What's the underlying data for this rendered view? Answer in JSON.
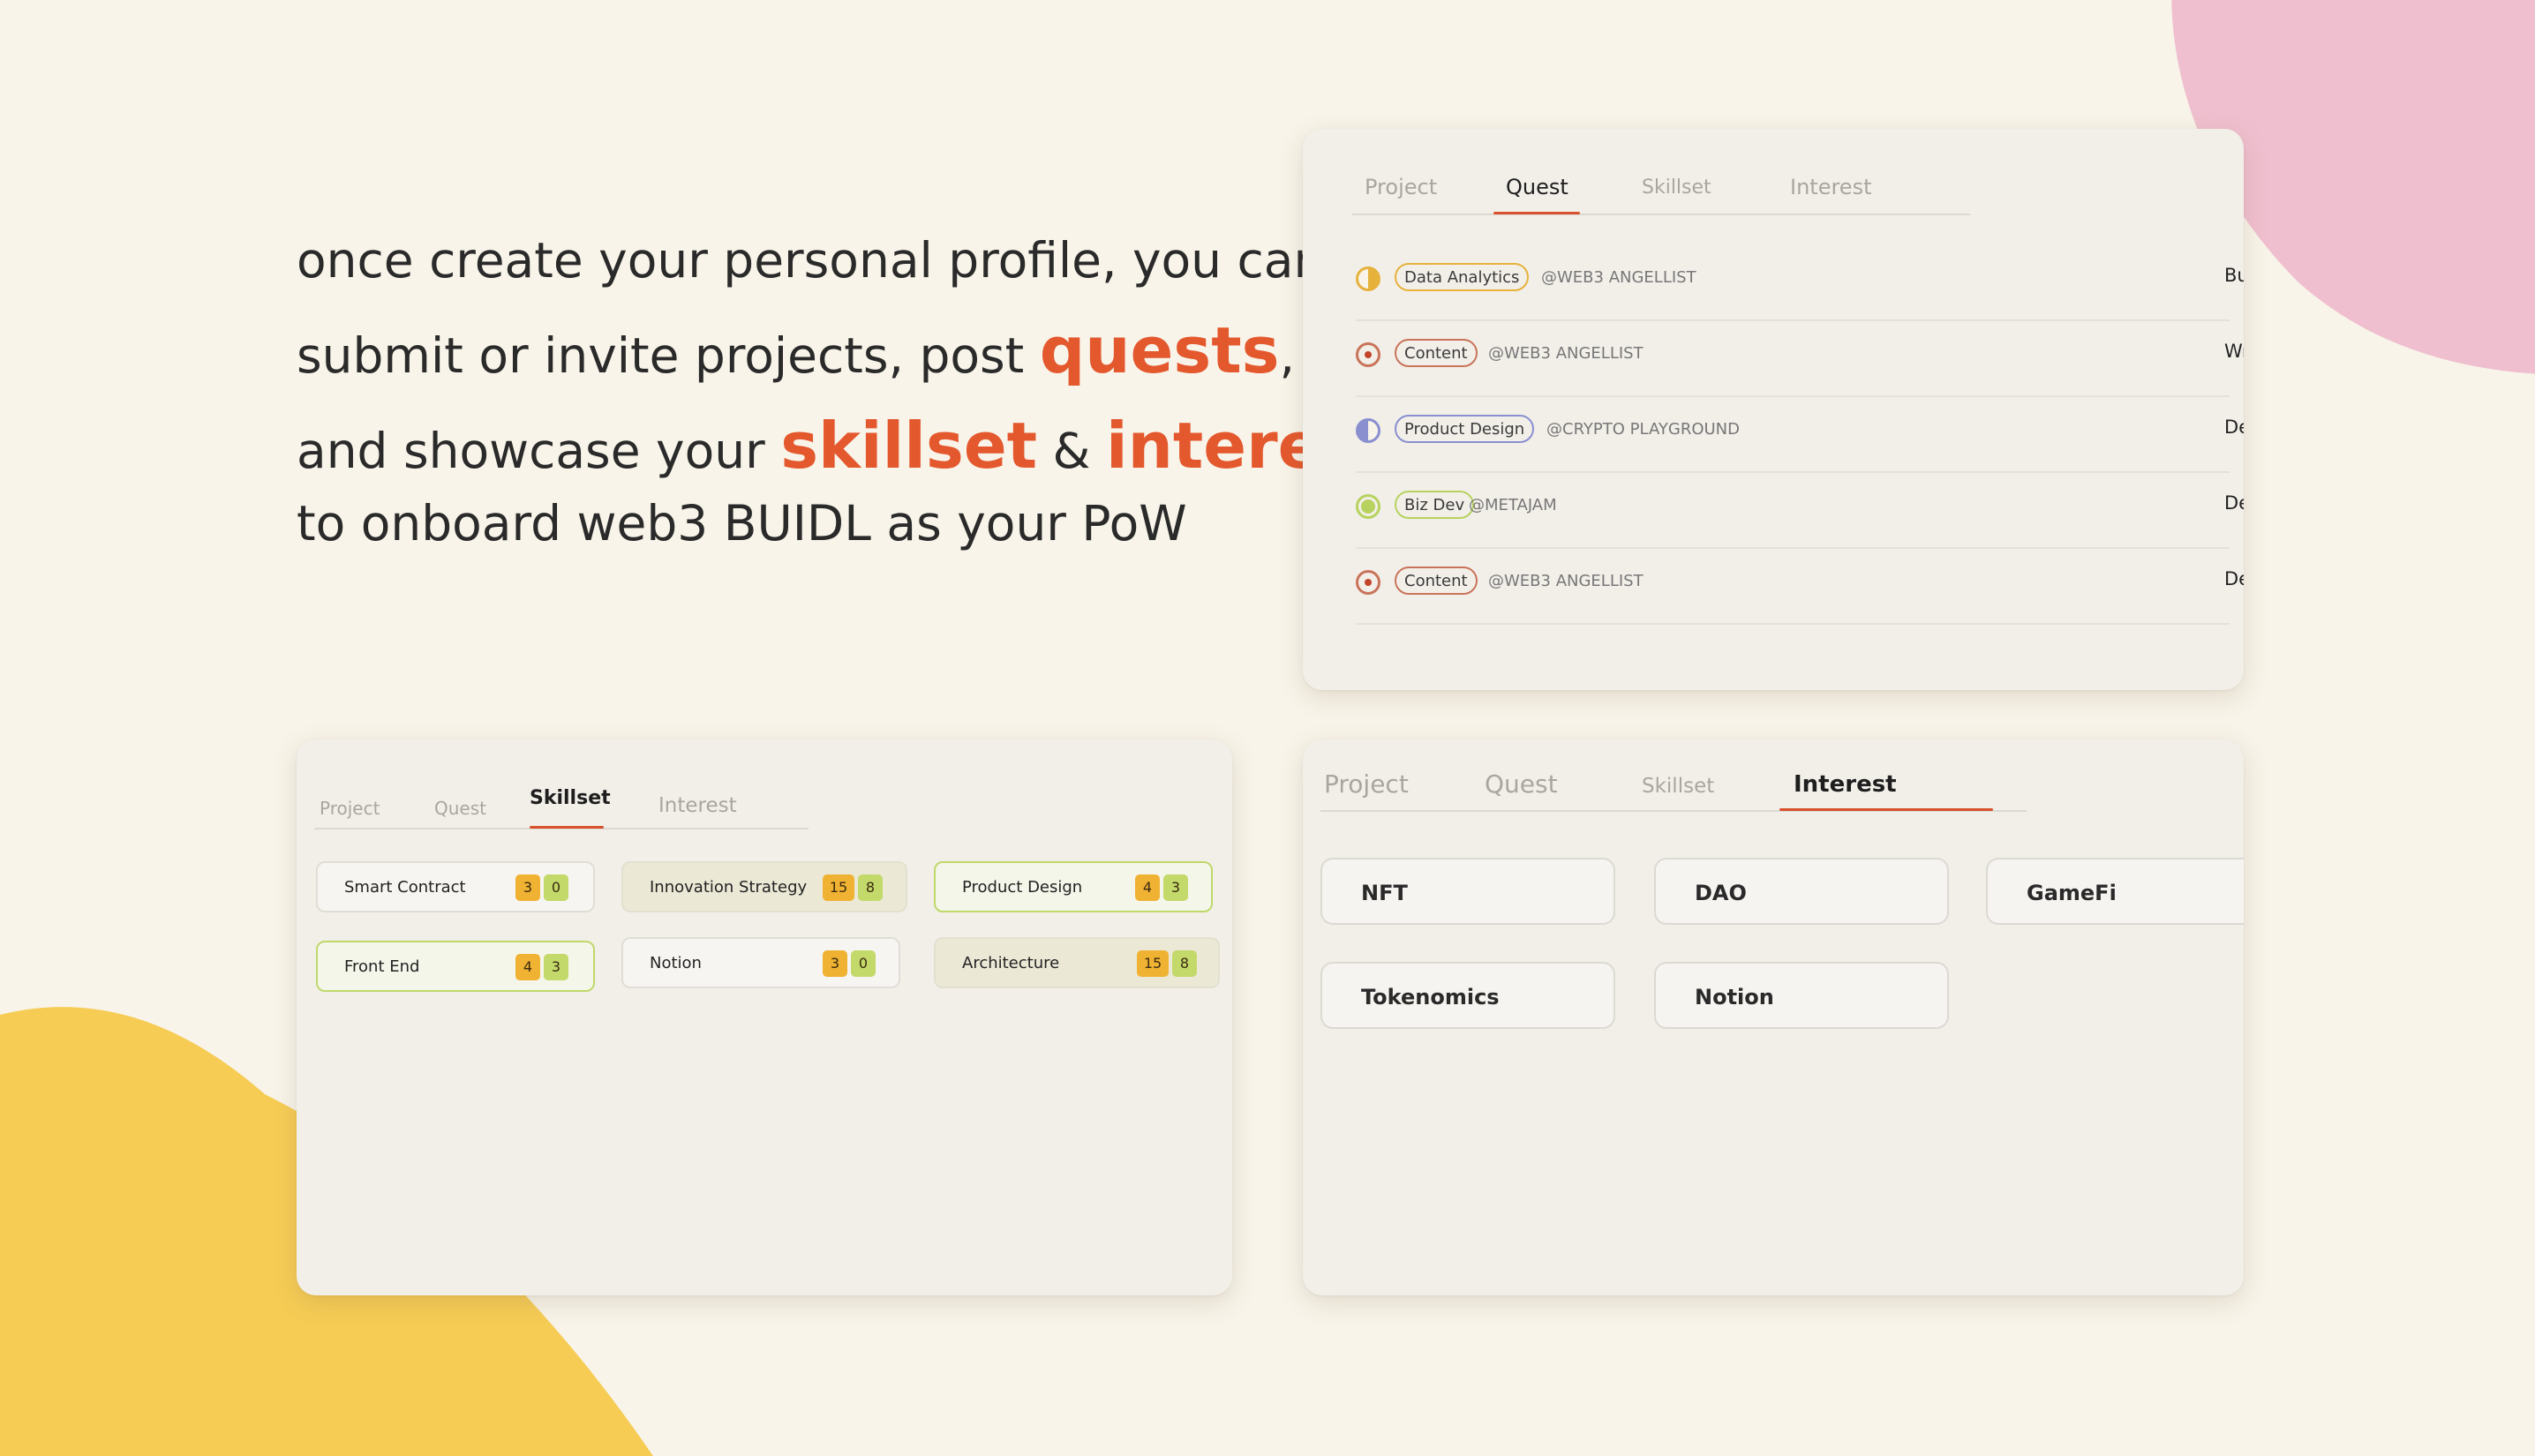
{
  "headline": {
    "line1": "once create your personal profile, you can",
    "line2_pre": "submit or invite projects, post ",
    "line2_hl": "quests",
    "line2_post": ",",
    "line3_pre": "and showcase your ",
    "line3_hl1": "skillset",
    "line3_mid": " & ",
    "line3_hl2": "interest",
    "line4": "to onboard web3 BUIDL as your PoW"
  },
  "colors": {
    "accent": "#e4582e",
    "pink_blob": "#f0bfcf",
    "yellow_blob": "#f6cc55",
    "background": "#f8f4e9"
  },
  "quest_card": {
    "tabs": [
      "Project",
      "Quest",
      "Skillset",
      "Interest"
    ],
    "active_tab": "Quest",
    "rows": [
      {
        "icon": "half-circle-yellow-icon",
        "tag": "Data Analytics",
        "tag_color": "#e6b23c",
        "handle": "@WEB3 ANGELLIST",
        "title": "Build a Dune Dashboard"
      },
      {
        "icon": "dot-circle-red-icon",
        "tag": "Content",
        "tag_color": "#c9745a",
        "handle": "@WEB3 ANGELLIST",
        "title": "Write a Mirror Article"
      },
      {
        "icon": "half-circle-blue-icon",
        "tag": "Product Design",
        "tag_color": "#8a8fd0",
        "handle": "@CRYPTO PLAYGROUND",
        "title": "Design a Figma Prototype"
      },
      {
        "icon": "filled-circle-green-icon",
        "tag": "Biz Dev",
        "tag_color": "#b7d25e",
        "handle": "@METAJAM",
        "title": "Design a Figma Prototype"
      },
      {
        "icon": "dot-circle-red-icon",
        "tag": "Content",
        "tag_color": "#c9745a",
        "handle": "@WEB3 ANGELLIST",
        "title": "Design a Figma Prototype"
      }
    ]
  },
  "skillset_card": {
    "tabs": [
      "Project",
      "Quest",
      "Skillset",
      "Interest"
    ],
    "active_tab": "Skillset",
    "skills": [
      {
        "name": "Smart Contract",
        "a": "3",
        "b": "0"
      },
      {
        "name": "Innovation Strategy",
        "a": "15",
        "b": "8"
      },
      {
        "name": "Product Design",
        "a": "4",
        "b": "3"
      },
      {
        "name": "Front End",
        "a": "4",
        "b": "3"
      },
      {
        "name": "Notion",
        "a": "3",
        "b": "0"
      },
      {
        "name": "Architecture",
        "a": "15",
        "b": "8"
      }
    ]
  },
  "interest_card": {
    "tabs": [
      "Project",
      "Quest",
      "Skillset",
      "Interest"
    ],
    "active_tab": "Interest",
    "interests": [
      "NFT",
      "DAO",
      "GameFi",
      "Tokenomics",
      "Notion"
    ]
  }
}
